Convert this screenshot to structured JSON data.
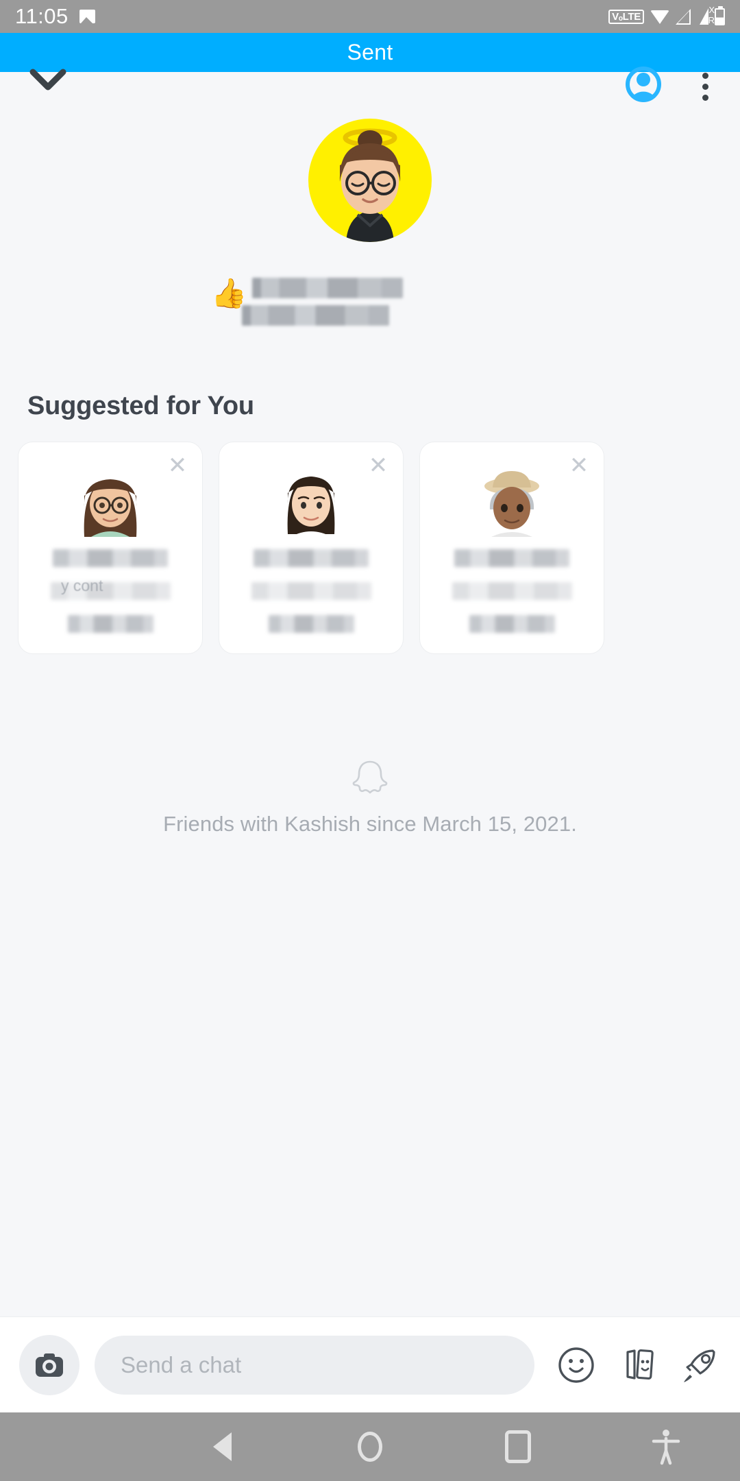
{
  "status_bar": {
    "time": "11:05",
    "icons": [
      "photo-icon",
      "volte-icon",
      "wifi-icon",
      "signal-icon",
      "signal-roaming-icon",
      "battery-icon"
    ],
    "volte_label": "VₒLTE",
    "signal_sup": "X",
    "signal_sub": "R",
    "background": "#9a9a9a"
  },
  "sent_banner": {
    "label": "Sent",
    "background": "#00aeff",
    "text_color": "#ffffff"
  },
  "chat_header": {
    "collapse_icon": "chevron-down-icon",
    "profile_icon": "profile-person-icon",
    "profile_icon_color": "#29b6ff",
    "overflow_icon": "kebab-menu-icon"
  },
  "conversation": {
    "avatar": {
      "name": "bitmoji-avatar",
      "background": "#fff000",
      "description": "bitmoji with halo, glasses, bun hair"
    },
    "message": {
      "emoji": "👍",
      "text": "[redacted]",
      "redacted": true,
      "lines": 2
    }
  },
  "suggested": {
    "heading": "Suggested for You",
    "heading_color": "#3f454e",
    "cards": [
      {
        "name_redacted": "[redacted]",
        "subtitle_hint": "y cont",
        "detail_redacted": "[redacted]",
        "close_icon": "close-x-icon",
        "bitmoji": "bitmoji-long-hair-glasses"
      },
      {
        "name_redacted": "[redacted]",
        "subtitle_hint": "",
        "detail_redacted": "[redacted]",
        "close_icon": "close-x-icon",
        "bitmoji": "bitmoji-dark-hair"
      },
      {
        "name_redacted": "[redacted]",
        "subtitle_hint": "",
        "detail_redacted": "[redacted]",
        "close_icon": "close-x-icon",
        "bitmoji": "bitmoji-hat-sunglasses"
      }
    ]
  },
  "friendship": {
    "icon": "snapchat-ghost-icon",
    "text": "Friends with Kashish since March 15, 2021.",
    "text_color": "#a7acb3"
  },
  "chat_bar": {
    "camera_icon": "camera-icon",
    "input_placeholder": "Send a chat",
    "input_value": "",
    "actions": [
      {
        "icon": "smiley-sticker-icon"
      },
      {
        "icon": "cards-stickers-icon"
      },
      {
        "icon": "rocket-icon"
      }
    ]
  },
  "nav_bar": {
    "buttons": [
      "back-button",
      "home-button",
      "recents-button",
      "accessibility-button"
    ],
    "background": "#9a9a9a",
    "icon_color": "#e3e3e3"
  }
}
